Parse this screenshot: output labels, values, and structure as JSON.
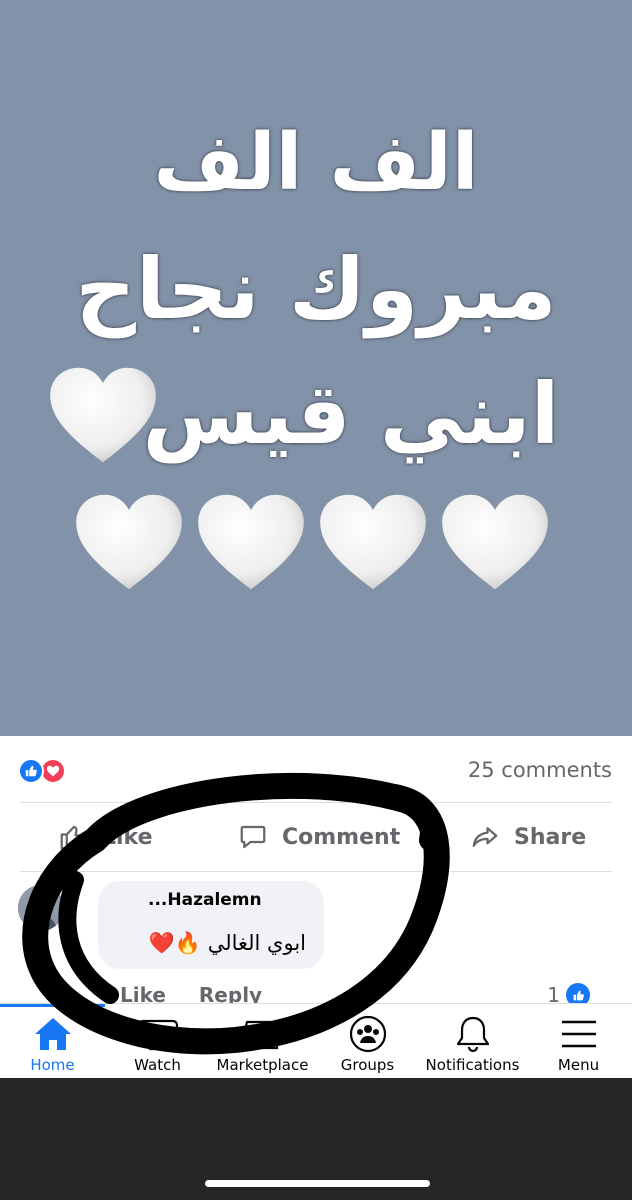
{
  "post": {
    "line1": "الف الف",
    "line2": "مبروك نجاح",
    "line3": "ابني قيس"
  },
  "reactions": {
    "types": [
      "like",
      "love"
    ],
    "comments_count": "25 comments"
  },
  "actions": {
    "like": "Like",
    "comment": "Comment",
    "share": "Share"
  },
  "comment": {
    "author": "...Hazalemn",
    "text": "ابوي الغالي 🔥❤️",
    "like_label": "Like",
    "reply_label": "Reply",
    "likes_count": "1"
  },
  "bottom_nav": {
    "items": [
      {
        "label": "Home",
        "icon": "home-icon",
        "active": true
      },
      {
        "label": "Watch",
        "icon": "watch-icon"
      },
      {
        "label": "Marketplace",
        "icon": "marketplace-icon"
      },
      {
        "label": "Groups",
        "icon": "groups-icon"
      },
      {
        "label": "Notifications",
        "icon": "bell-icon"
      },
      {
        "label": "Menu",
        "icon": "menu-icon"
      }
    ]
  },
  "colors": {
    "accent": "#1877f2",
    "love": "#f33e58",
    "post_background": "#8292a8",
    "annotation_ink": "#000000"
  }
}
